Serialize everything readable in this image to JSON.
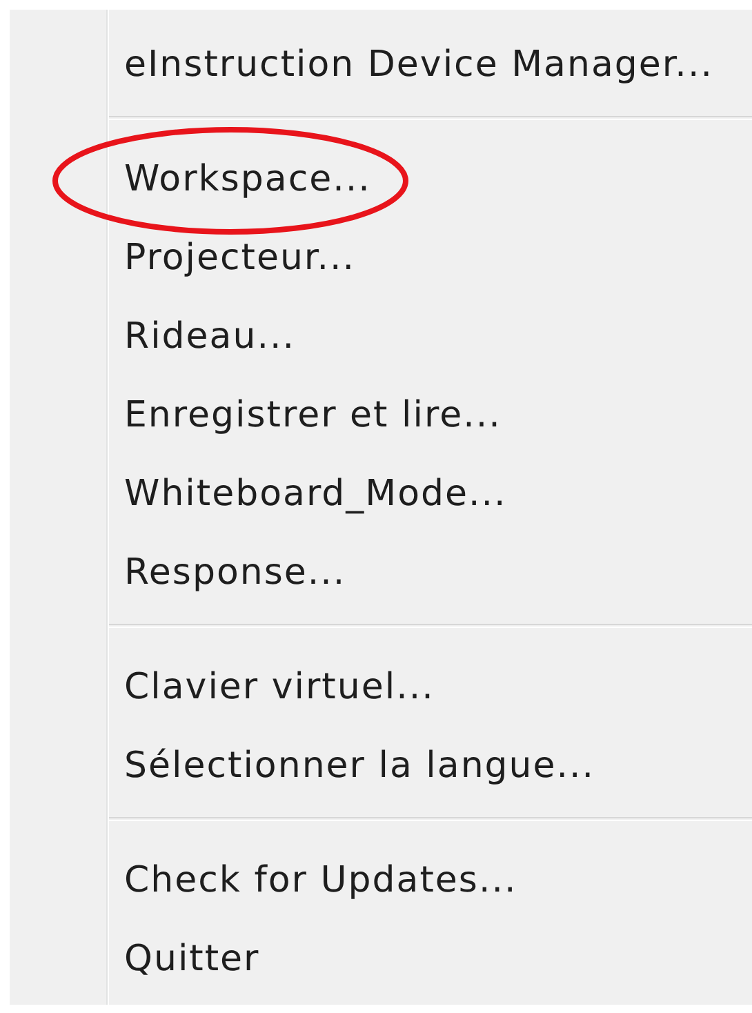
{
  "menu": {
    "groups": [
      {
        "items": [
          {
            "label": "eInstruction Device Manager...",
            "circled": false
          }
        ]
      },
      {
        "items": [
          {
            "label": "Workspace...",
            "circled": true
          },
          {
            "label": "Projecteur...",
            "circled": false
          },
          {
            "label": "Rideau...",
            "circled": false
          },
          {
            "label": "Enregistrer et lire...",
            "circled": false
          },
          {
            "label": "Whiteboard_Mode...",
            "circled": false
          },
          {
            "label": "Response...",
            "circled": false
          }
        ]
      },
      {
        "items": [
          {
            "label": "Clavier virtuel...",
            "circled": false
          },
          {
            "label": "Sélectionner la langue...",
            "circled": false
          }
        ]
      },
      {
        "items": [
          {
            "label": "Check for Updates...",
            "circled": false
          },
          {
            "label": "Quitter",
            "circled": false
          }
        ]
      }
    ]
  }
}
